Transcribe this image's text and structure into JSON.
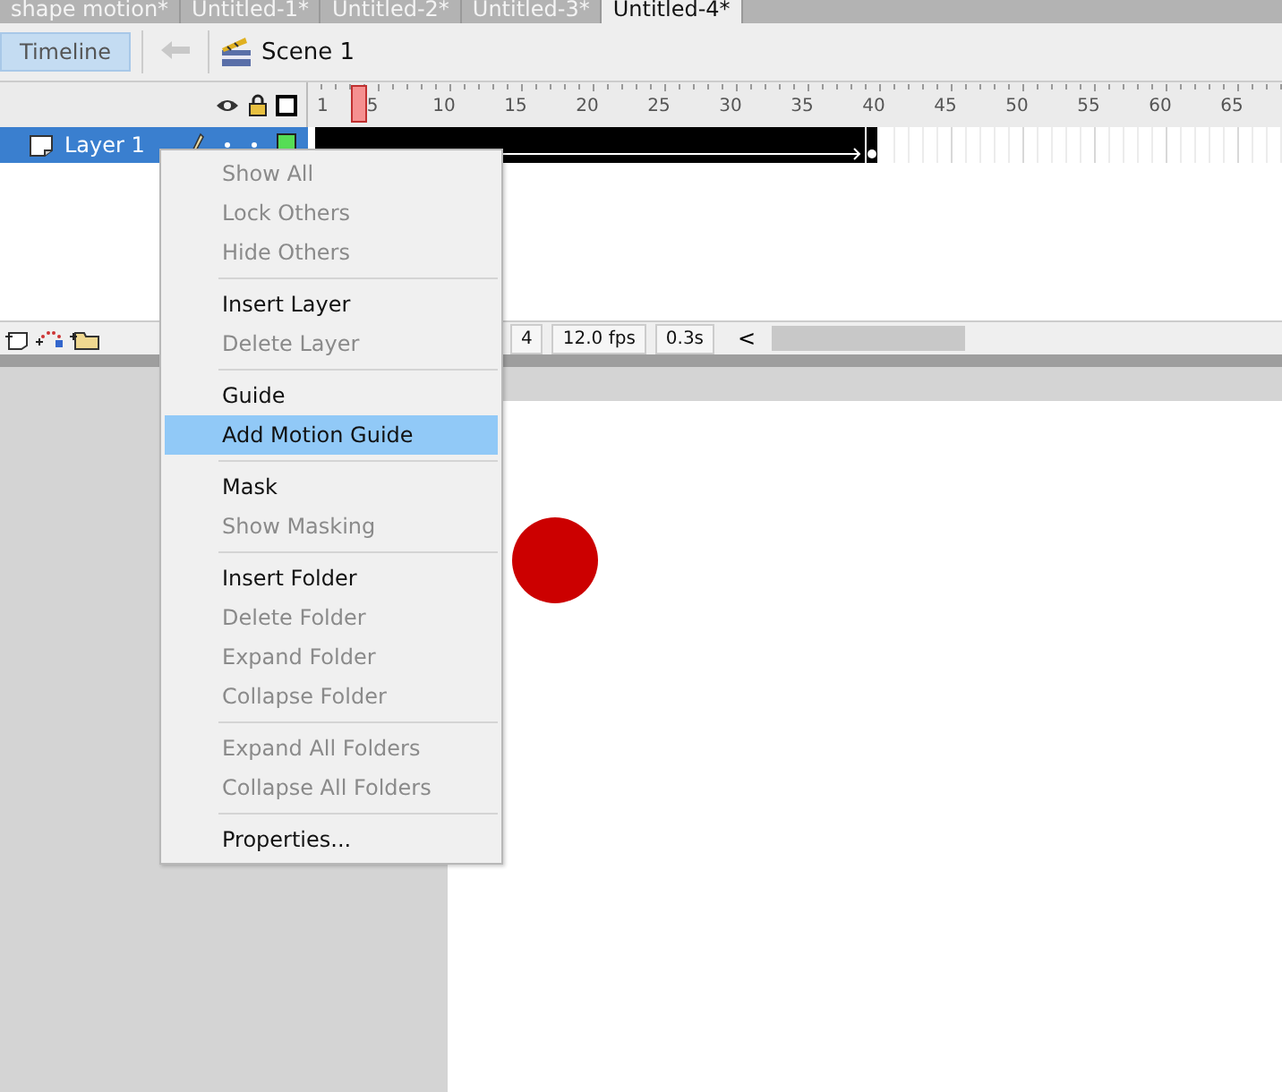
{
  "document_tabs": [
    {
      "label": "shape motion*",
      "selected": false
    },
    {
      "label": "Untitled-1*",
      "selected": false
    },
    {
      "label": "Untitled-2*",
      "selected": false
    },
    {
      "label": "Untitled-3*",
      "selected": false
    },
    {
      "label": "Untitled-4*",
      "selected": true
    }
  ],
  "toolbar": {
    "timeline_button": {
      "label": "Timeline",
      "selected": true
    },
    "back_disabled": true,
    "scene": "Scene 1"
  },
  "ruler": [
    "1",
    "5",
    "10",
    "15",
    "20",
    "25",
    "30",
    "35",
    "40",
    "45",
    "50",
    "55",
    "60",
    "65"
  ],
  "layers": [
    {
      "name": "Layer 1",
      "selected": true,
      "tween": {
        "level": 0.585
      }
    }
  ],
  "status": {
    "current_frame": "4",
    "frame_rate": "12.0 fps",
    "elapsed": "0.3s",
    "scroll_arrow": "<"
  },
  "context_menu": [
    [
      {
        "label": "Show All",
        "disabled": true,
        "selected": false
      },
      {
        "label": "Lock Others",
        "disabled": true,
        "selected": false
      },
      {
        "label": "Hide Others",
        "disabled": true,
        "selected": false
      }
    ],
    [
      {
        "label": "Insert Layer",
        "disabled": false,
        "selected": false
      },
      {
        "label": "Delete Layer",
        "disabled": true,
        "selected": false
      }
    ],
    [
      {
        "label": "Guide",
        "disabled": false,
        "selected": false
      },
      {
        "label": "Add Motion Guide",
        "disabled": false,
        "selected": true
      }
    ],
    [
      {
        "label": "Mask",
        "disabled": false,
        "selected": false
      },
      {
        "label": "Show Masking",
        "disabled": true,
        "selected": false
      }
    ],
    [
      {
        "label": "Insert Folder",
        "disabled": false,
        "selected": false
      },
      {
        "label": "Delete Folder",
        "disabled": true,
        "selected": false
      },
      {
        "label": "Expand Folder",
        "disabled": true,
        "selected": false
      },
      {
        "label": "Collapse Folder",
        "disabled": true,
        "selected": false
      }
    ],
    [
      {
        "label": "Expand All Folders",
        "disabled": true,
        "selected": false
      },
      {
        "label": "Collapse All Folders",
        "disabled": true,
        "selected": false
      }
    ],
    [
      {
        "label": "Properties...",
        "disabled": false,
        "selected": false
      }
    ]
  ]
}
